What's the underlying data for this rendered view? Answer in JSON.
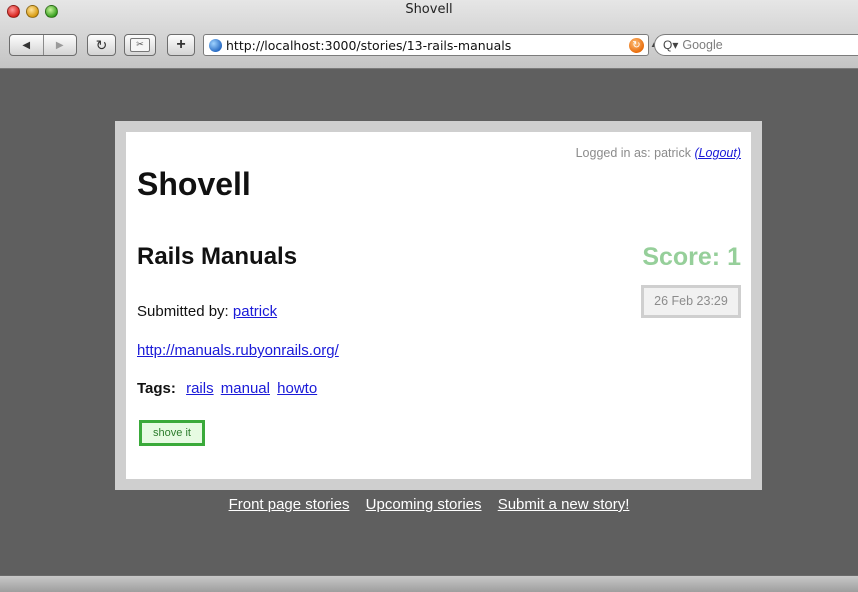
{
  "window": {
    "title": "Shovell"
  },
  "toolbar": {
    "back_glyph": "◀",
    "forward_glyph": "▶",
    "reload_glyph": "↻",
    "snapback_glyph": "✂",
    "add_bookmark_glyph": "+",
    "url": "http://localhost:3000/stories/13-rails-manuals",
    "search_placeholder": "Google",
    "search_icon_glyph": "Q▾"
  },
  "page": {
    "login_prefix": "Logged in as: patrick",
    "logout_label": "(Logout)",
    "site_title": "Shovell",
    "story": {
      "title": "Rails Manuals",
      "score_label": "Score: 1",
      "date": "26 Feb 23:29",
      "submitted_label": "Submitted by:",
      "submitted_by": "patrick",
      "link": "http://manuals.rubyonrails.org/",
      "tags_label": "Tags:",
      "tags": [
        "rails",
        "manual",
        "howto"
      ],
      "shove_label": "shove it"
    },
    "footer_nav": [
      "Front page stories",
      "Upcoming stories",
      "Submit a new story!"
    ]
  },
  "colors": {
    "page_bg": "#5f5f5f",
    "score": "#96cf9a",
    "link": "#1a1ad8",
    "shove_border": "#3aaa3a"
  }
}
